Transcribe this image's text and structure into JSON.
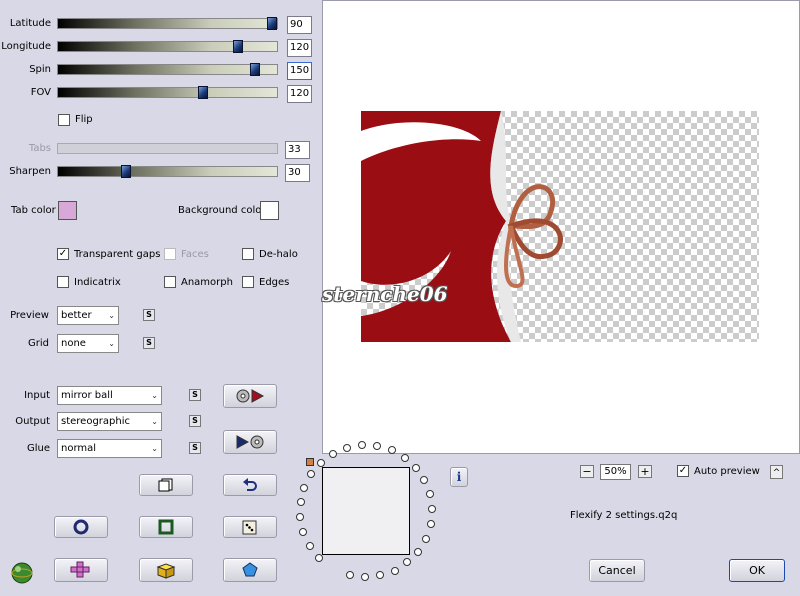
{
  "sliders": [
    {
      "key": "latitude",
      "label": "Latitude",
      "value": "90",
      "level": 0.97
    },
    {
      "key": "longitude",
      "label": "Longitude",
      "value": "120",
      "level": 0.82
    },
    {
      "key": "spin",
      "label": "Spin",
      "value": "150",
      "level": 0.89
    },
    {
      "key": "fov",
      "label": "FOV",
      "value": "120",
      "level": 0.66
    }
  ],
  "flip_label": "Flip",
  "tabs": {
    "label": "Tabs",
    "value": "33"
  },
  "sharpen": {
    "label": "Sharpen",
    "value": "30",
    "level": 0.3
  },
  "tab_color": {
    "label": "Tab color",
    "color": "#d8a8d8"
  },
  "background_color": {
    "label": "Background color",
    "color": "#ffffff"
  },
  "options": {
    "transparent_gaps": "Transparent gaps",
    "faces": "Faces",
    "de_halo": "De-halo",
    "indicatrix": "Indicatrix",
    "anamorph": "Anamorph",
    "edges": "Edges"
  },
  "preview": {
    "label": "Preview",
    "value": "better"
  },
  "grid": {
    "label": "Grid",
    "value": "none"
  },
  "input": {
    "label": "Input",
    "value": "mirror ball"
  },
  "output": {
    "label": "Output",
    "value": "stereographic"
  },
  "glue": {
    "label": "Glue",
    "value": "normal"
  },
  "s_label": "S",
  "watermark": "sternche06",
  "zoom": {
    "minus": "−",
    "value": "50%",
    "plus": "+"
  },
  "auto_preview": "Auto preview",
  "collapse": "^",
  "settings_file": "Flexify 2 settings.q2q",
  "info": "i",
  "cancel": "Cancel",
  "ok": "OK"
}
